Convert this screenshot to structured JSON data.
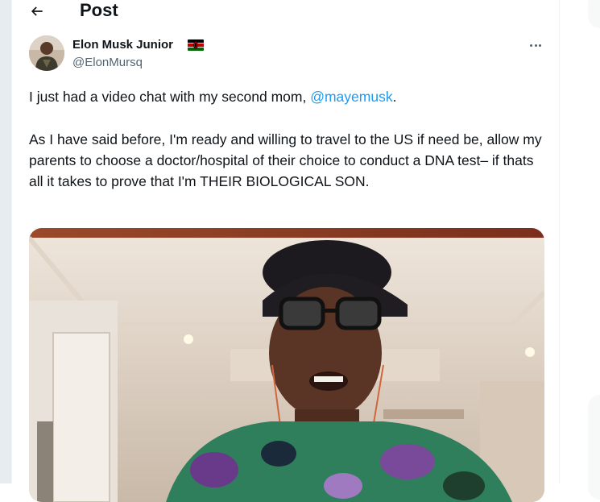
{
  "header": {
    "title": "Post"
  },
  "author": {
    "display_name": "Elon Musk Junior",
    "handle": "@ElonMursq"
  },
  "tweet": {
    "line1_text": "I just had a video chat with my second mom, ",
    "line1_mention": "@mayemusk",
    "line1_end": ".",
    "paragraph2": "As I have said before, I'm ready and willing to travel to the US if need be, allow my parents to choose a doctor/hospital of their choice to conduct a DNA test–  if thats all it takes to prove that I'm THEIR BIOLOGICAL SON."
  },
  "colors": {
    "accent": "#1d9bf0",
    "text": "#0f1419",
    "secondary_text": "#536471"
  },
  "icons": {
    "back": "arrow-left-icon",
    "more": "more-horizontal-icon",
    "flag": "kenya-flag-icon"
  }
}
